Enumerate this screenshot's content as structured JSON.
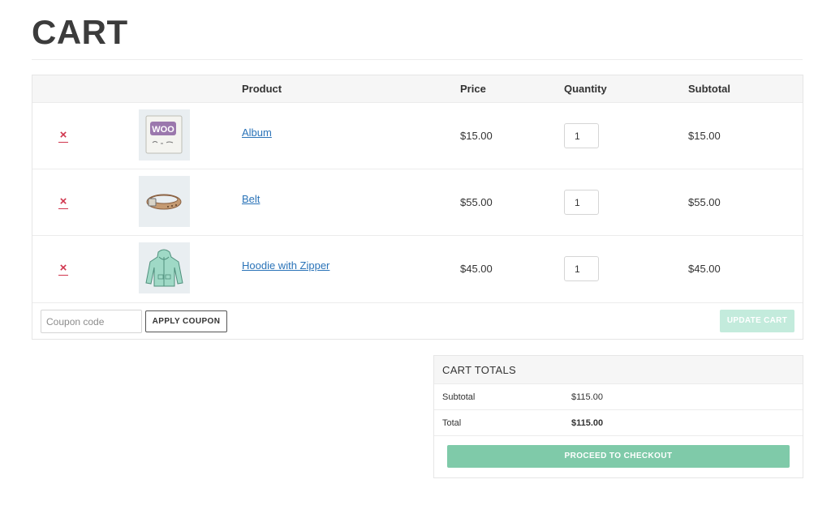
{
  "page": {
    "title": "CART"
  },
  "table": {
    "headers": {
      "product": "Product",
      "price": "Price",
      "quantity": "Quantity",
      "subtotal": "Subtotal"
    },
    "items": [
      {
        "name": "Album",
        "price": "$15.00",
        "quantity": "1",
        "subtotal": "$15.00",
        "remove_icon": "×",
        "thumb_icon": "album-image-icon"
      },
      {
        "name": "Belt",
        "price": "$55.00",
        "quantity": "1",
        "subtotal": "$55.00",
        "remove_icon": "×",
        "thumb_icon": "belt-image-icon"
      },
      {
        "name": "Hoodie with Zipper",
        "price": "$45.00",
        "quantity": "1",
        "subtotal": "$45.00",
        "remove_icon": "×",
        "thumb_icon": "hoodie-image-icon"
      }
    ]
  },
  "actions": {
    "coupon_placeholder": "Coupon code",
    "apply_coupon_label": "APPLY COUPON",
    "update_cart_label": "UPDATE CART"
  },
  "totals": {
    "title": "CART TOTALS",
    "subtotal_label": "Subtotal",
    "subtotal_value": "$115.00",
    "total_label": "Total",
    "total_value": "$115.00",
    "checkout_label": "PROCEED TO CHECKOUT"
  },
  "colors": {
    "accent_green": "#7fcaa9",
    "disabled_green": "#c3ebdc",
    "link_blue": "#2a73b8",
    "remove_red": "#d0354d"
  }
}
